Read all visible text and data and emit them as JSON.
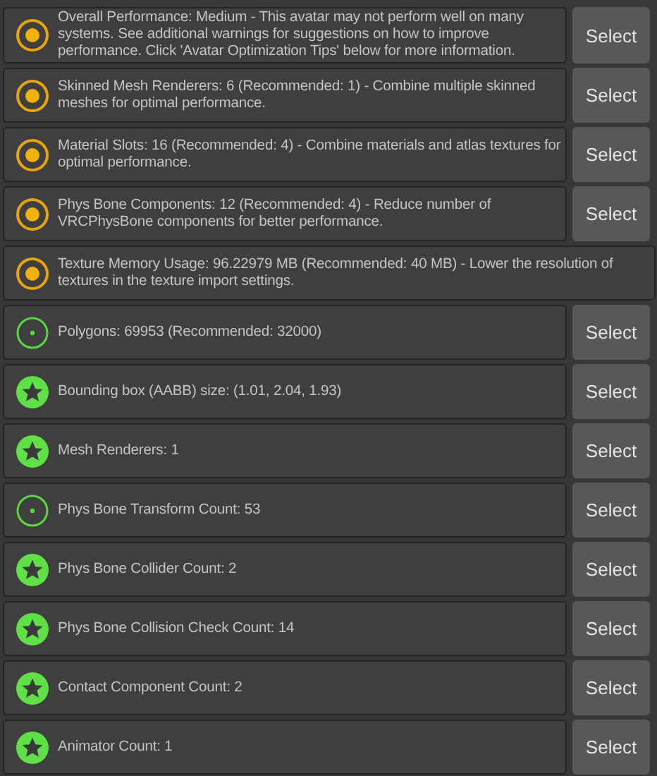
{
  "messages": [
    {
      "kind": "medium",
      "text": "Overall Performance: Medium - This avatar may not perform well on many systems. See additional warnings for suggestions on how to improve performance. Click 'Avatar Optimization Tips' below for more information.",
      "button": "Select"
    },
    {
      "kind": "medium",
      "text": "Skinned Mesh Renderers: 6 (Recommended: 1) - Combine multiple skinned meshes for optimal performance.",
      "button": "Select"
    },
    {
      "kind": "medium",
      "text": "Material Slots: 16 (Recommended: 4) - Combine materials and atlas textures for optimal performance.",
      "button": "Select"
    },
    {
      "kind": "medium",
      "text": "Phys Bone Components: 12 (Recommended: 4) - Reduce number of VRCPhysBone components for better performance.",
      "button": "Select"
    },
    {
      "kind": "medium",
      "text": "Texture Memory Usage: 96.22979 MB (Recommended: 40 MB) - Lower the resolution of textures in the texture import settings."
    },
    {
      "kind": "good",
      "text": "Polygons: 69953 (Recommended: 32000)",
      "button": "Select"
    },
    {
      "kind": "excellent",
      "text": "Bounding box (AABB) size: (1.01, 2.04, 1.93)",
      "button": "Select"
    },
    {
      "kind": "excellent",
      "text": "Mesh Renderers: 1",
      "button": "Select"
    },
    {
      "kind": "good",
      "text": "Phys Bone Transform Count: 53",
      "button": "Select"
    },
    {
      "kind": "excellent",
      "text": "Phys Bone Collider Count: 2",
      "button": "Select"
    },
    {
      "kind": "excellent",
      "text": "Phys Bone Collision Check Count: 14",
      "button": "Select"
    },
    {
      "kind": "excellent",
      "text": "Contact Component Count: 2",
      "button": "Select"
    },
    {
      "kind": "excellent",
      "text": "Animator Count: 1",
      "button": "Select"
    }
  ]
}
